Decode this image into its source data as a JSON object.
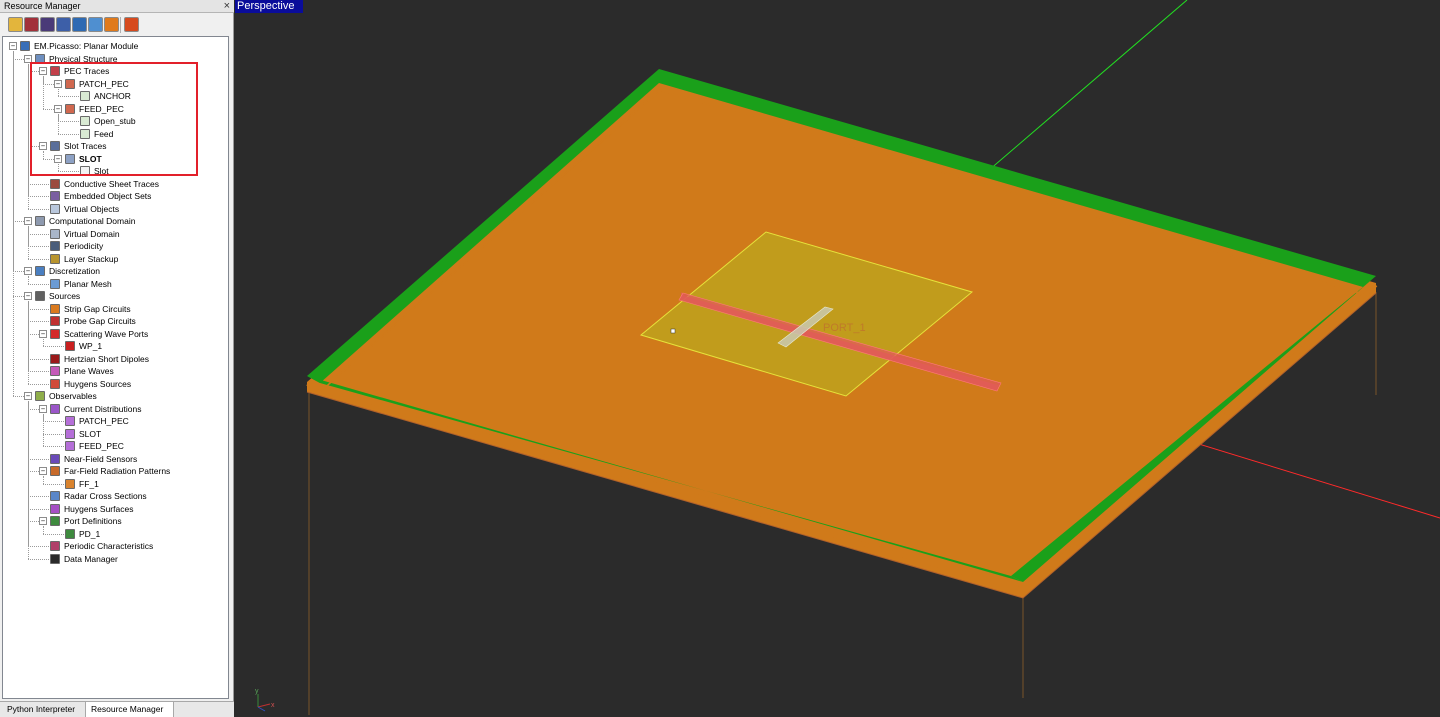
{
  "panel": {
    "title": "Resource Manager",
    "close_glyph": "×",
    "toolbar": [
      {
        "icon": "project-icon",
        "color": "#e3b53c"
      },
      {
        "icon": "material-icon",
        "color": "#a2303a"
      },
      {
        "icon": "mesh-icon",
        "color": "#4a3a78"
      },
      {
        "icon": "domain-icon",
        "color": "#3d5fa8"
      },
      {
        "icon": "module-icon",
        "color": "#2e6ab3"
      },
      {
        "icon": "transform-icon",
        "color": "#4f8fd0"
      },
      {
        "icon": "sources-icon",
        "color": "#e07a1c"
      },
      {
        "icon": "target-icon",
        "color": "#d64a1e"
      }
    ],
    "tree": [
      {
        "label": "EM.Picasso: Planar Module",
        "level": 0,
        "toggle": "−",
        "icon": "module-tree-icon",
        "color": "#3a6fb8"
      },
      {
        "label": "Physical Structure",
        "level": 1,
        "toggle": "−",
        "icon": "physical-structure-icon",
        "color": "#6e8fbf"
      },
      {
        "label": "PEC Traces",
        "level": 2,
        "toggle": "−",
        "icon": "pec-traces-icon",
        "color": "#c2404a"
      },
      {
        "label": "PATCH_PEC",
        "level": 3,
        "toggle": "−",
        "icon": "pec-group-icon",
        "color": "#d0684f"
      },
      {
        "label": "ANCHOR",
        "level": 4,
        "toggle": "",
        "icon": "rectangle-object-icon",
        "color": "#d9ead3"
      },
      {
        "label": "FEED_PEC",
        "level": 3,
        "toggle": "−",
        "icon": "pec-group-icon",
        "color": "#d0684f"
      },
      {
        "label": "Open_stub",
        "level": 4,
        "toggle": "",
        "icon": "rectangle-object-icon",
        "color": "#d9ead3"
      },
      {
        "label": "Feed",
        "level": 4,
        "toggle": "",
        "icon": "rectangle-object-icon",
        "color": "#d9ead3"
      },
      {
        "label": "Slot Traces",
        "level": 2,
        "toggle": "−",
        "icon": "slot-traces-icon",
        "color": "#5b6f9a"
      },
      {
        "label": "SLOT",
        "level": 3,
        "toggle": "−",
        "icon": "slot-group-icon",
        "color": "#8da1c4",
        "bold": true
      },
      {
        "label": "Slot",
        "level": 4,
        "toggle": "",
        "icon": "rectangle-object-icon",
        "color": "#f3f3f3"
      },
      {
        "label": "Conductive Sheet Traces",
        "level": 2,
        "toggle": "",
        "icon": "conductive-sheet-icon",
        "color": "#9b4a3e"
      },
      {
        "label": "Embedded Object Sets",
        "level": 2,
        "toggle": "",
        "icon": "embedded-object-icon",
        "color": "#7a5fa0"
      },
      {
        "label": "Virtual Objects",
        "level": 2,
        "toggle": "",
        "icon": "virtual-object-icon",
        "color": "#b9c7dc"
      },
      {
        "label": "Computational Domain",
        "level": 1,
        "toggle": "−",
        "icon": "computational-domain-icon",
        "color": "#8e9aaf"
      },
      {
        "label": "Virtual Domain",
        "level": 2,
        "toggle": "",
        "icon": "virtual-domain-icon",
        "color": "#a9b6c9"
      },
      {
        "label": "Periodicity",
        "level": 2,
        "toggle": "",
        "icon": "periodicity-icon",
        "color": "#4a5d7a"
      },
      {
        "label": "Layer Stackup",
        "level": 2,
        "toggle": "",
        "icon": "layer-stackup-icon",
        "color": "#b8942e"
      },
      {
        "label": "Discretization",
        "level": 1,
        "toggle": "−",
        "icon": "discretization-icon",
        "color": "#4a7fc1"
      },
      {
        "label": "Planar Mesh",
        "level": 2,
        "toggle": "",
        "icon": "planar-mesh-icon",
        "color": "#6b9bd4"
      },
      {
        "label": "Sources",
        "level": 1,
        "toggle": "−",
        "icon": "sources-tree-icon",
        "color": "#606060"
      },
      {
        "label": "Strip Gap Circuits",
        "level": 2,
        "toggle": "",
        "icon": "strip-gap-icon",
        "color": "#d97a1e"
      },
      {
        "label": "Probe Gap Circuits",
        "level": 2,
        "toggle": "",
        "icon": "probe-gap-icon",
        "color": "#c03030"
      },
      {
        "label": "Scattering Wave Ports",
        "level": 2,
        "toggle": "−",
        "icon": "wave-port-icon",
        "color": "#d42a2a"
      },
      {
        "label": "WP_1",
        "level": 3,
        "toggle": "",
        "icon": "wave-port-item-icon",
        "color": "#c91f1f"
      },
      {
        "label": "Hertzian Short Dipoles",
        "level": 2,
        "toggle": "",
        "icon": "dipole-icon",
        "color": "#9a1a1a"
      },
      {
        "label": "Plane Waves",
        "level": 2,
        "toggle": "",
        "icon": "plane-wave-icon",
        "color": "#c45ab8"
      },
      {
        "label": "Huygens Sources",
        "level": 2,
        "toggle": "",
        "icon": "huygens-source-icon",
        "color": "#d04a3a"
      },
      {
        "label": "Observables",
        "level": 1,
        "toggle": "−",
        "icon": "observables-icon",
        "color": "#8fae4a"
      },
      {
        "label": "Current Distributions",
        "level": 2,
        "toggle": "−",
        "icon": "current-distribution-icon",
        "color": "#9a56c8"
      },
      {
        "label": "PATCH_PEC",
        "level": 3,
        "toggle": "",
        "icon": "current-item-icon",
        "color": "#b56fd8"
      },
      {
        "label": "SLOT",
        "level": 3,
        "toggle": "",
        "icon": "current-item-icon",
        "color": "#b56fd8"
      },
      {
        "label": "FEED_PEC",
        "level": 3,
        "toggle": "",
        "icon": "current-item-icon",
        "color": "#b56fd8"
      },
      {
        "label": "Near-Field Sensors",
        "level": 2,
        "toggle": "",
        "icon": "near-field-icon",
        "color": "#6a4ab8"
      },
      {
        "label": "Far-Field Radiation Patterns",
        "level": 2,
        "toggle": "−",
        "icon": "far-field-icon",
        "color": "#c76a2a"
      },
      {
        "label": "FF_1",
        "level": 3,
        "toggle": "",
        "icon": "far-field-item-icon",
        "color": "#d9832e"
      },
      {
        "label": "Radar Cross Sections",
        "level": 2,
        "toggle": "",
        "icon": "rcs-icon",
        "color": "#5a86c8"
      },
      {
        "label": "Huygens Surfaces",
        "level": 2,
        "toggle": "",
        "icon": "huygens-surface-icon",
        "color": "#a64fc4"
      },
      {
        "label": "Port Definitions",
        "level": 2,
        "toggle": "−",
        "icon": "port-definition-icon",
        "color": "#3e8a3e"
      },
      {
        "label": "PD_1",
        "level": 3,
        "toggle": "",
        "icon": "port-definition-item-icon",
        "color": "#3e8a3e"
      },
      {
        "label": "Periodic Characteristics",
        "level": 2,
        "toggle": "",
        "icon": "periodic-characteristics-icon",
        "color": "#b0406a"
      },
      {
        "label": "Data Manager",
        "level": 2,
        "toggle": "",
        "icon": "data-manager-icon",
        "color": "#2a2a2a"
      }
    ]
  },
  "tabs": [
    {
      "label": "Python Interpreter",
      "active": false
    },
    {
      "label": "Resource Manager",
      "active": true
    }
  ],
  "viewport": {
    "view_label": "Perspective",
    "port_label": "PORT_1",
    "axis_labels": {
      "y": "y",
      "x": "x"
    },
    "colors": {
      "background": "#2b2b2b",
      "ground_top": "#1aa01a",
      "ground_side": "#d07a1a",
      "patch": "#b8b21e",
      "feed": "#e25a5a",
      "x_axis": "#ff2a2a",
      "z_axis": "#22e022"
    }
  }
}
